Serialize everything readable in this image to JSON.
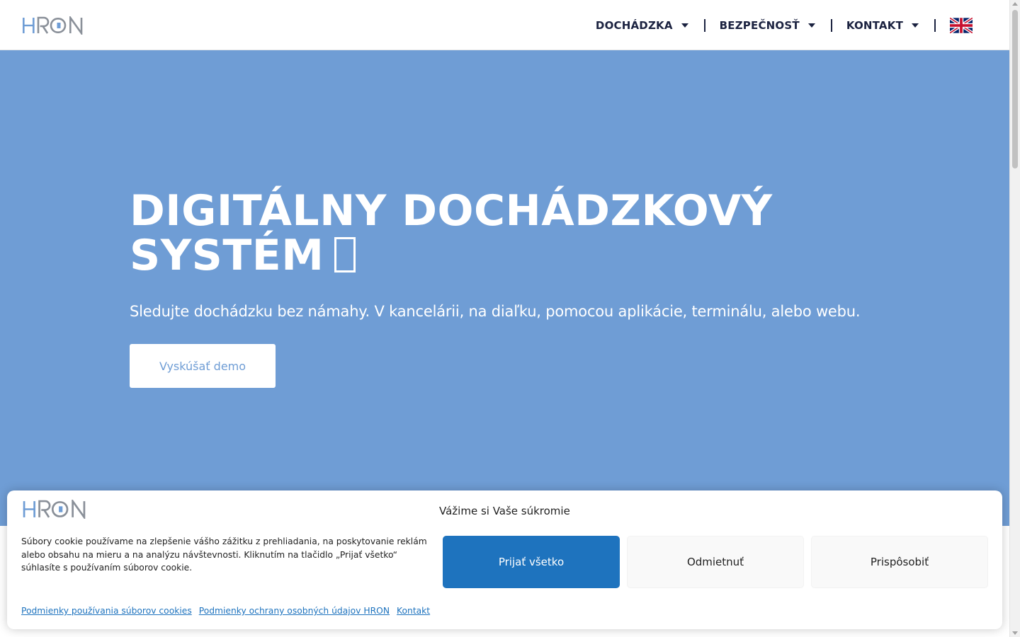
{
  "header": {
    "logo_text": "HRON",
    "nav": [
      {
        "label": "DOCHÁDZKA",
        "icon": "caret-down-icon"
      },
      {
        "label": "BEZPEČNOSŤ",
        "icon": "caret-down-icon"
      },
      {
        "label": "KONTAKT",
        "icon": "caret-down-icon"
      }
    ],
    "language_flag": "uk-flag-icon"
  },
  "hero": {
    "title_line1": "DIGITÁLNY DOCHÁDZKOVÝ",
    "title_line2": "SYSTÉM",
    "title_icon": "missing-glyph-icon",
    "subtitle": "Sledujte dochádzku bez námahy. V kancelárii, na diaľku, pomocou aplikácie, terminálu, alebo webu.",
    "cta_label": "Vyskúšať demo",
    "background_color": "#6f9dd5"
  },
  "cookie_banner": {
    "logo_text": "HRON",
    "title": "Vážime si Vaše súkromie",
    "text": "Súbory cookie používame na zlepšenie vášho zážitku z prehliadania, na poskytovanie reklám alebo obsahu na mieru a na analýzu návštevnosti. Kliknutím na tlačidlo „Prijať všetko“ súhlasíte s používaním súborov cookie.",
    "buttons": {
      "accept": "Prijať všetko",
      "deny": "Odmietnuť",
      "customize": "Prispôsobiť"
    },
    "links": [
      "Podmienky používania súborov cookies",
      "Podmienky ochrany osobných údajov HRON",
      "Kontakt"
    ],
    "accent_color": "#1e73be"
  },
  "colors": {
    "nav_text": "#1b2240",
    "logo_blue": "#6f9dd5",
    "logo_gray": "#8a9099"
  }
}
